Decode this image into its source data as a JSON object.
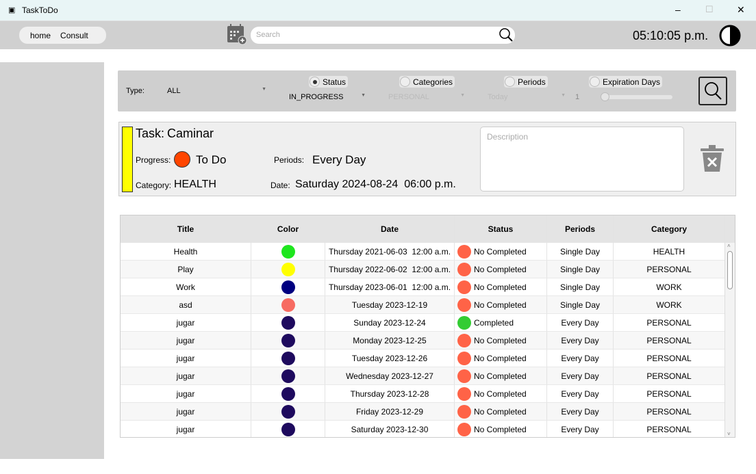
{
  "window": {
    "title": "TaskToDo",
    "min": "–",
    "max": "☐",
    "close": "✕"
  },
  "toolbar": {
    "nav": [
      "home",
      "Consult"
    ],
    "search_placeholder": "Search",
    "clock": "05:10:05 p.m."
  },
  "filter": {
    "type_label": "Type:",
    "type_value": "ALL",
    "radios": [
      {
        "label": "Status",
        "checked": true
      },
      {
        "label": "Categories",
        "checked": false
      },
      {
        "label": "Periods",
        "checked": false
      },
      {
        "label": "Expiration Days",
        "checked": false
      }
    ],
    "status_value": "IN_PROGRESS",
    "category_value": "PERSONAL",
    "period_value": "Today",
    "days_value": "1",
    "slider_level": 0
  },
  "task": {
    "title_label": "Task:",
    "title": "Caminar",
    "color": "#ffff00",
    "progress_label": "Progress:",
    "progress": "To Do",
    "progress_color": "#ff4500",
    "periods_label": "Periods:",
    "periods": "Every Day",
    "category_label": "Category:",
    "category": "HEALTH",
    "date_label": "Date:",
    "date": "Saturday 2024-08-24  06:00 p.m.",
    "description_placeholder": "Description"
  },
  "table": {
    "headers": [
      "Title",
      "Color",
      "Date",
      "Status",
      "Periods",
      "Category"
    ],
    "rows": [
      {
        "title": "Health",
        "color": "#1ee61e",
        "date": "Thursday 2021-06-03  12:00 a.m.",
        "status": "No Completed",
        "periods": "Single Day",
        "category": "HEALTH"
      },
      {
        "title": "Play",
        "color": "#ffff00",
        "date": "Thursday 2022-06-02  12:00 a.m.",
        "status": "No Completed",
        "periods": "Single Day",
        "category": "PERSONAL"
      },
      {
        "title": "Work",
        "color": "#000080",
        "date": "Thursday 2023-06-01  12:00 a.m.",
        "status": "No Completed",
        "periods": "Single Day",
        "category": "WORK"
      },
      {
        "title": "asd",
        "color": "#f76b62",
        "date": "Tuesday 2023-12-19",
        "status": "No Completed",
        "periods": "Single Day",
        "category": "WORK"
      },
      {
        "title": "jugar",
        "color": "#1e0a5e",
        "date": "Sunday 2023-12-24",
        "status": "Completed",
        "periods": "Every Day",
        "category": "PERSONAL"
      },
      {
        "title": "jugar",
        "color": "#1e0a5e",
        "date": "Monday 2023-12-25",
        "status": "No Completed",
        "periods": "Every Day",
        "category": "PERSONAL"
      },
      {
        "title": "jugar",
        "color": "#1e0a5e",
        "date": "Tuesday 2023-12-26",
        "status": "No Completed",
        "periods": "Every Day",
        "category": "PERSONAL"
      },
      {
        "title": "jugar",
        "color": "#1e0a5e",
        "date": "Wednesday 2023-12-27",
        "status": "No Completed",
        "periods": "Every Day",
        "category": "PERSONAL"
      },
      {
        "title": "jugar",
        "color": "#1e0a5e",
        "date": "Thursday 2023-12-28",
        "status": "No Completed",
        "periods": "Every Day",
        "category": "PERSONAL"
      },
      {
        "title": "jugar",
        "color": "#1e0a5e",
        "date": "Friday 2023-12-29",
        "status": "No Completed",
        "periods": "Every Day",
        "category": "PERSONAL"
      },
      {
        "title": "jugar",
        "color": "#1e0a5e",
        "date": "Saturday 2023-12-30",
        "status": "No Completed",
        "periods": "Every Day",
        "category": "PERSONAL"
      }
    ]
  },
  "colors": {
    "completed": "#33cc33",
    "not_completed": "#ff6347"
  }
}
